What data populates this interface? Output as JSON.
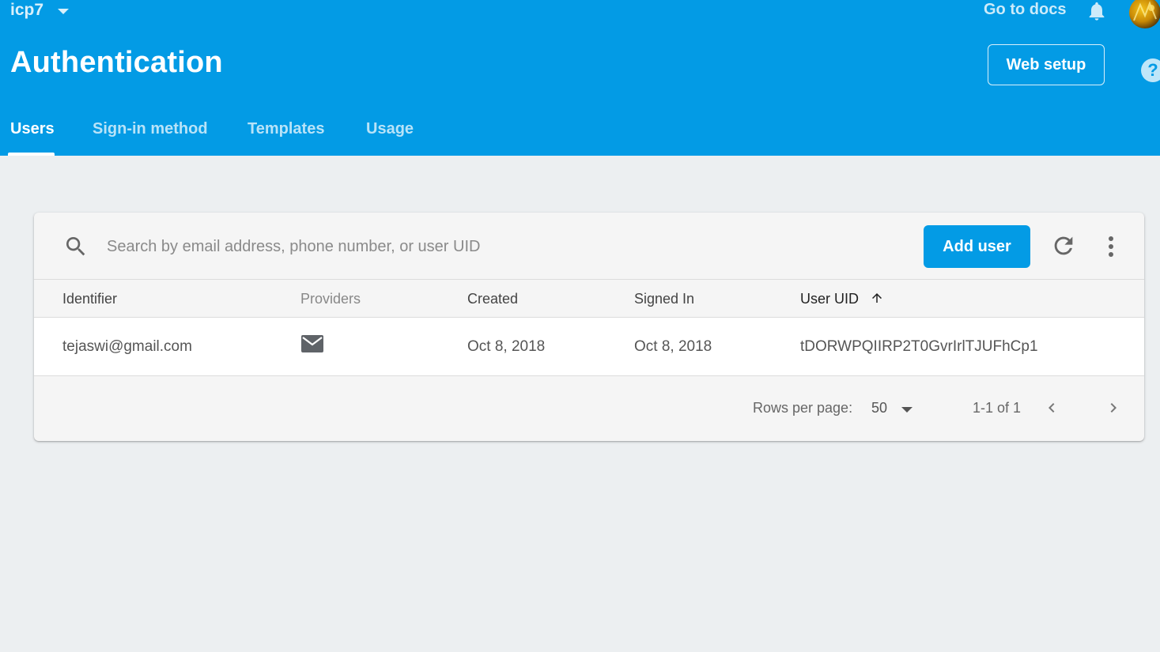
{
  "header": {
    "project_name": "icp7",
    "docs_link": "Go to docs",
    "title": "Authentication",
    "web_setup_label": "Web setup",
    "help_glyph": "?",
    "tabs": [
      {
        "label": "Users",
        "active": true
      },
      {
        "label": "Sign-in method",
        "active": false
      },
      {
        "label": "Templates",
        "active": false
      },
      {
        "label": "Usage",
        "active": false
      }
    ]
  },
  "users_panel": {
    "search_placeholder": "Search by email address, phone number, or user UID",
    "add_user_label": "Add user",
    "columns": [
      "Identifier",
      "Providers",
      "Created",
      "Signed In",
      "User UID"
    ],
    "sorted_column": "User UID",
    "sort_direction": "ascending",
    "rows": [
      {
        "identifier": "tejaswi@gmail.com",
        "provider_icon": "mail-icon",
        "created": "Oct 8, 2018",
        "signed_in": "Oct 8, 2018",
        "uid": "tDORWPQIIRP2T0GvrIrlTJUFhCp1"
      }
    ],
    "pagination": {
      "rows_per_page_label": "Rows per page:",
      "rows_per_page_value": "50",
      "range_text": "1-1 of 1"
    }
  },
  "colors": {
    "header_bg": "#039be5",
    "page_bg": "#eceff1",
    "primary_button": "#039be5"
  }
}
